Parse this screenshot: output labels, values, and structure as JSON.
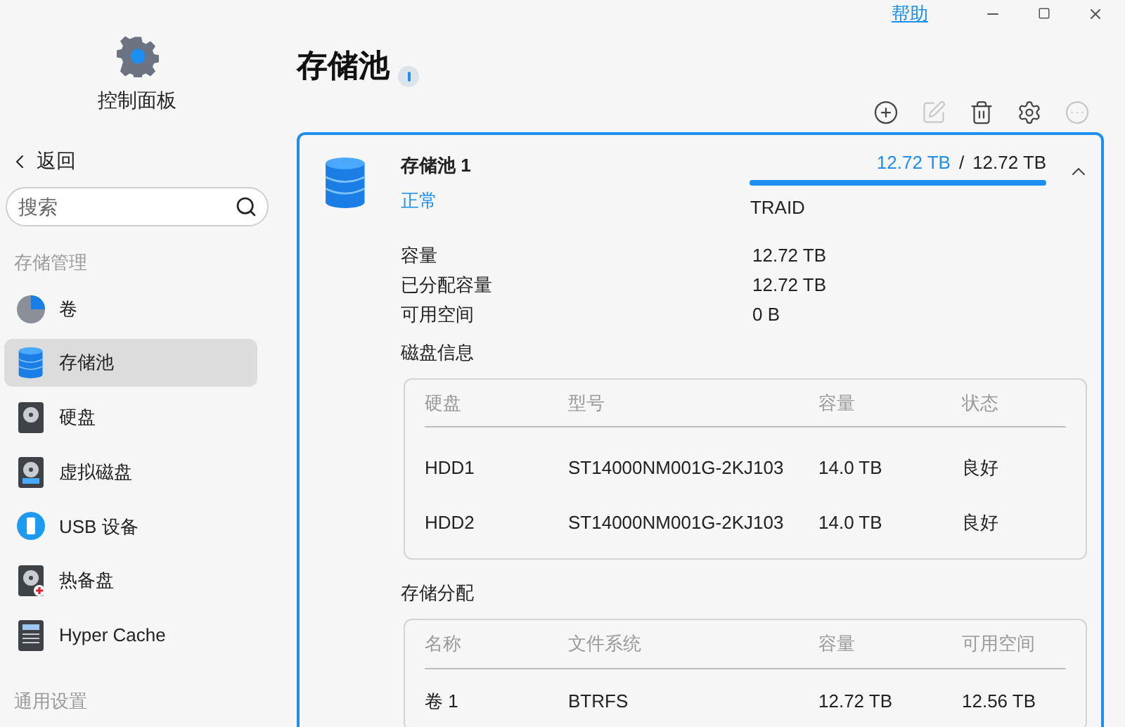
{
  "window": {
    "help_link": "帮助"
  },
  "sidebar": {
    "app_title": "控制面板",
    "back": "返回",
    "search": {
      "placeholder": "搜索"
    },
    "sections": [
      {
        "title": "存储管理",
        "items": [
          {
            "label": "卷",
            "kind": "volume",
            "selected": false
          },
          {
            "label": "存储池",
            "kind": "pool",
            "selected": true
          },
          {
            "label": "硬盘",
            "kind": "hdd",
            "selected": false
          },
          {
            "label": "虚拟磁盘",
            "kind": "vdisk",
            "selected": false
          },
          {
            "label": "USB 设备",
            "kind": "usb",
            "selected": false
          },
          {
            "label": "热备盘",
            "kind": "spare",
            "selected": false
          },
          {
            "label": "Hyper Cache",
            "kind": "cache",
            "selected": false
          }
        ]
      },
      {
        "title": "通用设置"
      }
    ]
  },
  "page": {
    "title": "存储池",
    "toolbar": [
      {
        "kind": "add",
        "disabled": false
      },
      {
        "kind": "edit",
        "disabled": true
      },
      {
        "kind": "delete",
        "disabled": false
      },
      {
        "kind": "settings",
        "disabled": false
      },
      {
        "kind": "more",
        "disabled": true
      }
    ],
    "pool": {
      "name": "存储池 1",
      "status": "正常",
      "used": "12.72 TB",
      "separator": "/",
      "total": "12.72 TB",
      "level": 1,
      "raid": "TRAID",
      "expanded": true,
      "details": [
        {
          "label": "容量",
          "value": "12.72 TB"
        },
        {
          "label": "已分配容量",
          "value": "12.72 TB"
        },
        {
          "label": "可用空间",
          "value": "0 B"
        }
      ],
      "disk_info": {
        "title": "磁盘信息",
        "columns": [
          "硬盘",
          "型号",
          "容量",
          "状态"
        ],
        "rows": [
          [
            "HDD1",
            "ST14000NM001G-2KJ103",
            "14.0 TB",
            "良好"
          ],
          [
            "HDD2",
            "ST14000NM001G-2KJ103",
            "14.0 TB",
            "良好"
          ]
        ]
      },
      "allocation": {
        "title": "存储分配",
        "columns": [
          "名称",
          "文件系统",
          "容量",
          "可用空间"
        ],
        "rows": [
          [
            "卷 1",
            "BTRFS",
            "12.72 TB",
            "12.56 TB"
          ]
        ]
      }
    }
  }
}
